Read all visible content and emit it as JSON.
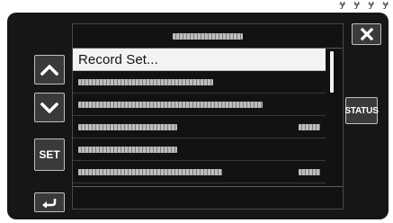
{
  "top_corner_text": "ɏ ɏ ɏ ɏ",
  "header": {
    "title_placeholder": "blurred"
  },
  "list": {
    "items": [
      {
        "label": "Record Set...",
        "selected": true
      },
      {
        "label": "",
        "selected": false
      },
      {
        "label": "",
        "selected": false
      },
      {
        "label": "",
        "selected": false
      },
      {
        "label": "",
        "selected": false
      },
      {
        "label": "",
        "selected": false
      }
    ]
  },
  "buttons": {
    "up_icon": "chevron-up-icon",
    "down_icon": "chevron-down-icon",
    "set_label": "SET",
    "back_icon": "return-arrow-icon",
    "close_icon": "close-x-icon",
    "status_label": "STATUS"
  },
  "colors": {
    "background": "#161616",
    "button_fill": "#3a3a3a",
    "selection": "#f3f3f3"
  }
}
